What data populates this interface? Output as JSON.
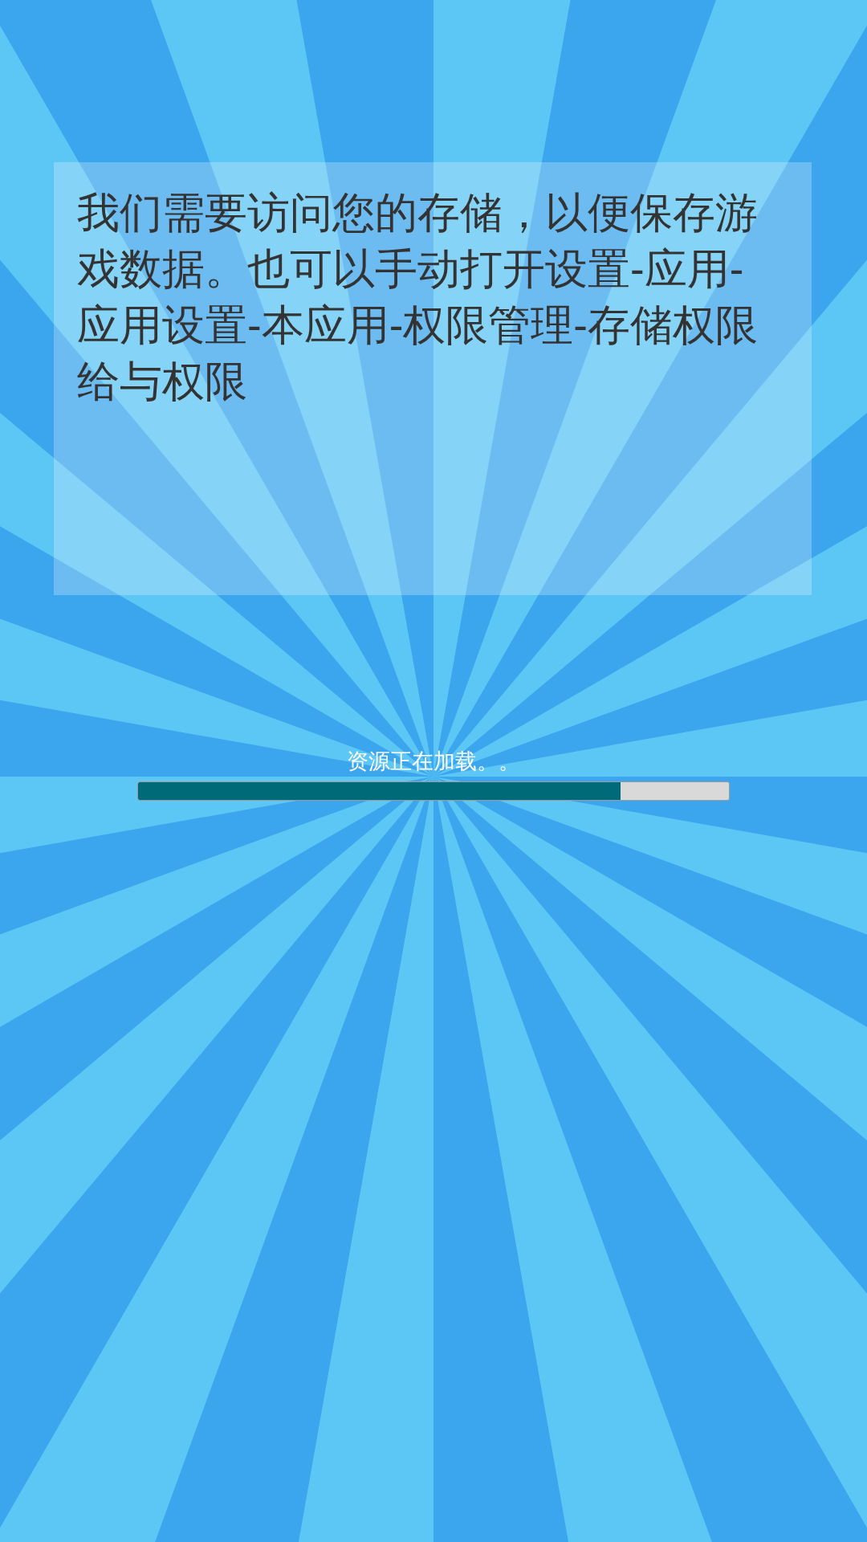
{
  "permission_notice": {
    "message": "我们需要访问您的存储，以便保存游戏数据。也可以手动打开设置-应用-应用设置-本应用-权限管理-存储权限给与权限"
  },
  "loading": {
    "label": "资源正在加载。。",
    "level": 0.817
  }
}
